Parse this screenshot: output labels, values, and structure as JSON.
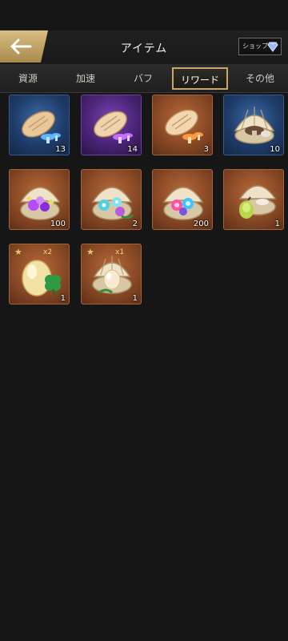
{
  "header": {
    "title": "アイテム",
    "shop_label": "ショップ"
  },
  "tabs": [
    {
      "label": "資源",
      "active": false
    },
    {
      "label": "加速",
      "active": false
    },
    {
      "label": "バフ",
      "active": false
    },
    {
      "label": "リワード",
      "active": true
    },
    {
      "label": "その他",
      "active": false
    }
  ],
  "items": [
    {
      "frame": "blue",
      "icon": "blue-mushroom-bread-icon",
      "quantity": "13"
    },
    {
      "frame": "purple",
      "icon": "purple-mushroom-bread-icon",
      "quantity": "14"
    },
    {
      "frame": "orange",
      "icon": "orange-mushroom-bread-icon",
      "quantity": "3"
    },
    {
      "frame": "blue",
      "icon": "clam-with-mushroom-icon",
      "quantity": "10"
    },
    {
      "frame": "orange",
      "icon": "clam-with-purple-coral-icon",
      "quantity": "100"
    },
    {
      "frame": "orange",
      "icon": "clam-with-blue-flowers-icon",
      "quantity": "2"
    },
    {
      "frame": "orange",
      "icon": "clam-with-jewels-icon",
      "quantity": "200"
    },
    {
      "frame": "orange",
      "icon": "clam-with-fruit-icon",
      "quantity": "1"
    },
    {
      "frame": "orange",
      "icon": "golden-egg-clover-icon",
      "quantity": "1",
      "star": "★",
      "multiplier": "x2"
    },
    {
      "frame": "orange",
      "icon": "clam-with-pearl-icon",
      "quantity": "1",
      "star": "★",
      "multiplier": "x1"
    }
  ],
  "colors": {
    "accent_gold": "#c9a867",
    "background": "#161616"
  }
}
